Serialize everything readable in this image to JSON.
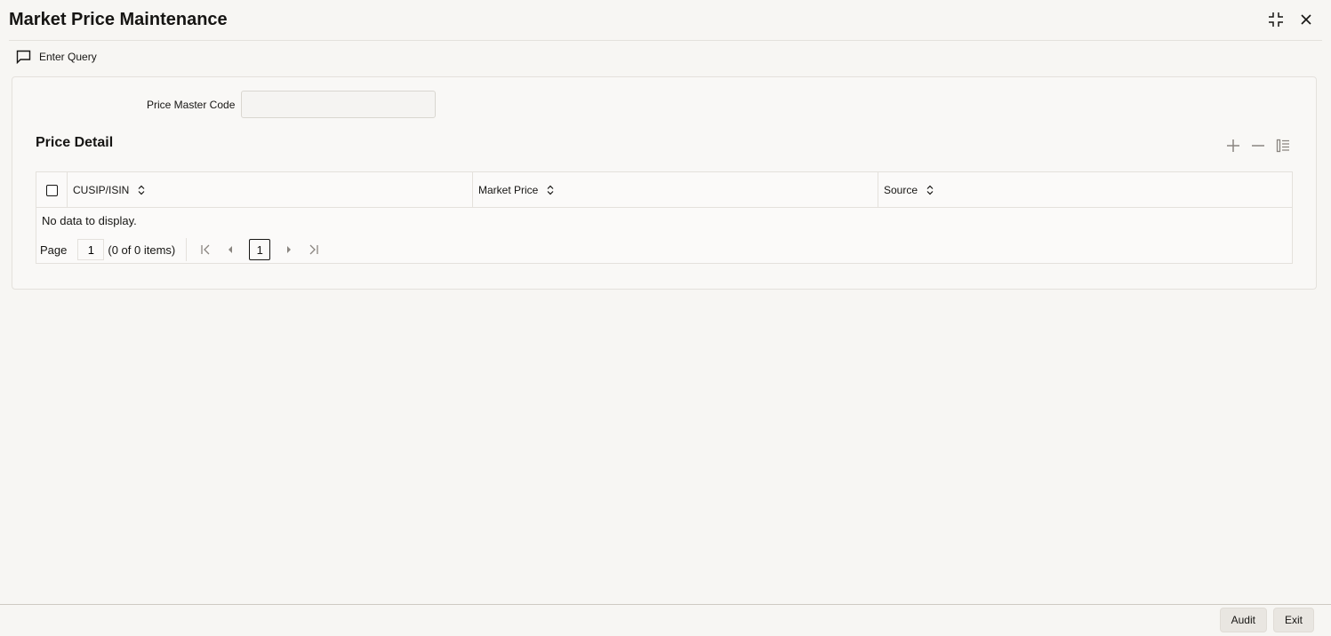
{
  "window": {
    "title": "Market Price Maintenance",
    "minimize_icon": "collapse-icon",
    "close_icon": "close-icon"
  },
  "toolbar": {
    "enter_query_label": "Enter Query",
    "enter_query_icon": "query-icon"
  },
  "form": {
    "price_master_code_label": "Price Master Code",
    "price_master_code_value": ""
  },
  "price_detail": {
    "title": "Price Detail",
    "actions": [
      "add-icon",
      "remove-icon",
      "single-record-view-icon"
    ],
    "columns": [
      "CUSIP/ISIN",
      "Market Price",
      "Source"
    ],
    "rows": [],
    "empty_message": "No data to display.",
    "pagination": {
      "page_label": "Page",
      "page_value": "1",
      "items_count": "(0 of 0 items)",
      "current_page": "1"
    }
  },
  "footer": {
    "audit_label": "Audit",
    "exit_label": "Exit"
  }
}
